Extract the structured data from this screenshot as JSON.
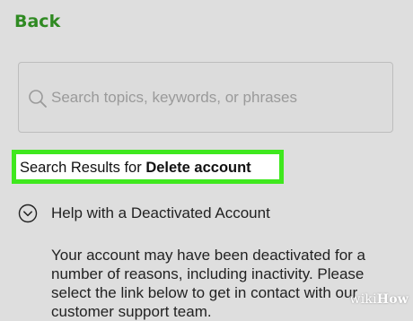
{
  "header": {
    "back_label": "Back"
  },
  "search": {
    "placeholder": "Search topics, keywords, or phrases",
    "value": ""
  },
  "results": {
    "prefix": "Search Results for ",
    "query": "Delete account"
  },
  "help_item": {
    "title": "Help with a Deactivated Account",
    "expanded": true,
    "body": "Your account may have been deactivated for a number of reasons, including inactivity. Please select the link below to get in contact with our customer support team."
  },
  "watermark": {
    "wiki": "wiki",
    "how": "How"
  },
  "colors": {
    "background": "#dedede",
    "accent_green": "#2f8a22",
    "highlight_green": "#3fe81e"
  },
  "icons": {
    "search": "search-icon",
    "expand": "chevron-down-circle-icon"
  }
}
